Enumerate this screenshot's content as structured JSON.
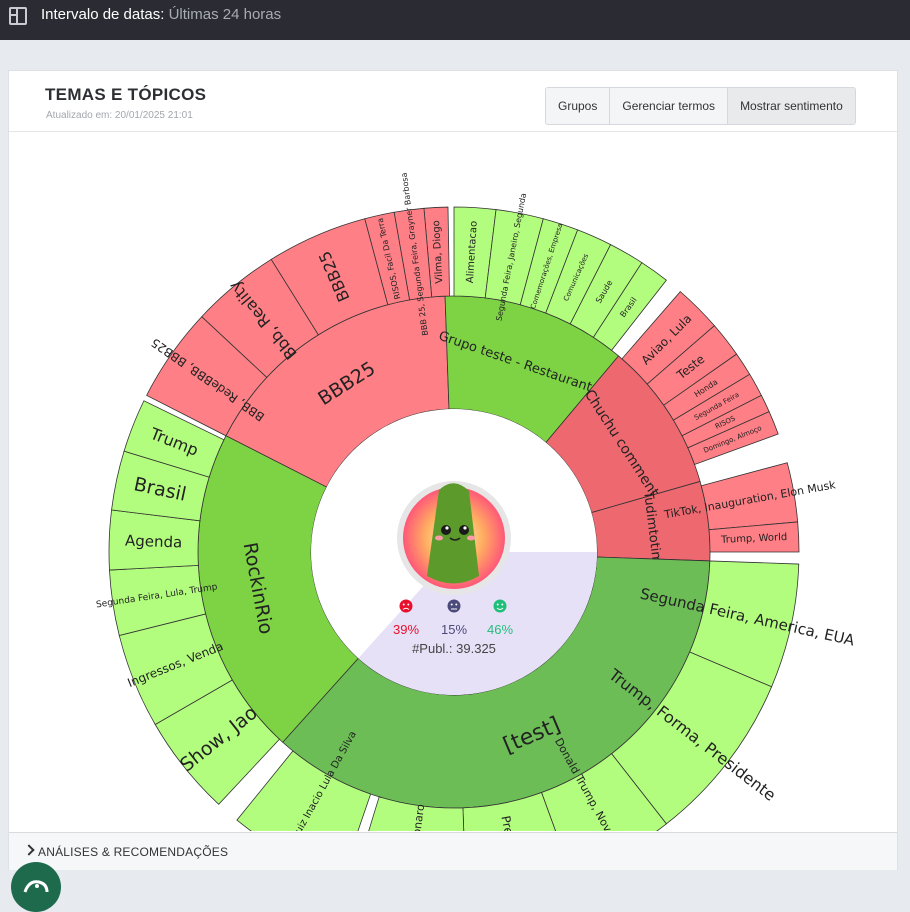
{
  "header": {
    "label": "Intervalo de datas:",
    "value": "Últimas 24 horas"
  },
  "card": {
    "title": "TEMAS E TÓPICOS",
    "updated": "Atualizado em: 20/01/2025 21:01"
  },
  "buttons": [
    "Grupos",
    "Gerenciar termos",
    "Mostrar sentimento"
  ],
  "center": {
    "neg": "39%",
    "neu": "15%",
    "pos": "46%",
    "total": "#Publ.: 39.325"
  },
  "colors": {
    "negative": "#ff7f86",
    "negative_dark": "#ee6870",
    "positive_mid": "#7dd344",
    "positive_dark": "#6cbd56",
    "positive_light": "#b3fd7e",
    "center_bg": "#e7e1f8"
  },
  "groups": [
    "BBB25",
    "Grupo teste - Restaurante",
    "Chuchu comment",
    "Tudimtotim",
    "[test]",
    "RockinRio"
  ],
  "topics": [
    "Vilma, Diogo",
    "BBB 25, Segunda Feira, Grayner Barbosa",
    "RISOS, Facil Da Terra",
    "BBB25",
    "Bbb, Reality",
    "BBB, RedeBBB, BBB25",
    "Alimentacao",
    "Segunda Feira, Janeiro, Segunda",
    "Comemorações, Empresa",
    "Comunicações",
    "Saude",
    "Brasil",
    "Aviao, Lula",
    "Teste",
    "Honda",
    "Segunda Feira",
    "RISOS",
    "Domingo, Almoço",
    "TikTok, Inauguration, Elon Musk",
    "Trump, World",
    "Segunda Feira, America, EUA",
    "Trump, Forma, Presidente",
    "Donald Trump, Novo Presidente",
    "Presidente",
    "Brasil, Bolsonaro",
    "Lula, Projeto, Luiz Inacio Lula Da Silva",
    "Show, Jao",
    "Ingressos, Venda",
    "Segunda Feira, Lula, Trump",
    "Agenda",
    "Brasil",
    "Trump"
  ],
  "footer": {
    "label": "ANÁLISES & RECOMENDAÇÕES"
  }
}
